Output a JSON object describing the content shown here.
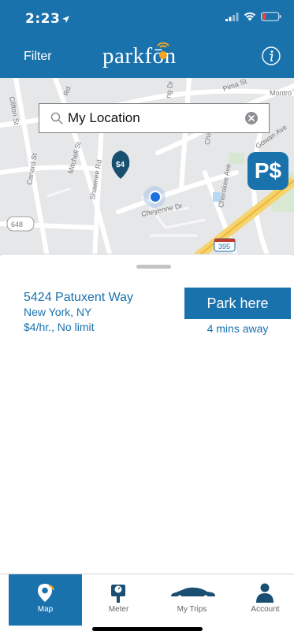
{
  "status": {
    "time": "2:23"
  },
  "header": {
    "filter_label": "Filter",
    "logo_text": "parkfōn"
  },
  "search": {
    "value": "My Location"
  },
  "map": {
    "badge": "P$",
    "marker_label": "$4",
    "street_labels": [
      "Pima St",
      "Montro",
      "Clifton St",
      "Rd",
      "ng Dr",
      "Cha",
      "Gowan Ave",
      "Canard St",
      "Mitchell St",
      "Shawnee Rd",
      "Cheyenne Dr",
      "Cherokee Ave",
      "648",
      "395"
    ]
  },
  "sheet": {
    "address_line1": "5424 Patuxent Way",
    "address_line2": "New York, NY",
    "rate": "$4/hr., No limit",
    "park_button": "Park here",
    "distance": "4 mins away"
  },
  "tabs": [
    {
      "label": "Map",
      "icon": "map-pin-icon"
    },
    {
      "label": "Meter",
      "icon": "parking-meter-icon"
    },
    {
      "label": "My Trips",
      "icon": "car-icon"
    },
    {
      "label": "Account",
      "icon": "person-icon"
    }
  ],
  "colors": {
    "brand": "#1a72ad",
    "logo_accent": "#f5a623"
  }
}
